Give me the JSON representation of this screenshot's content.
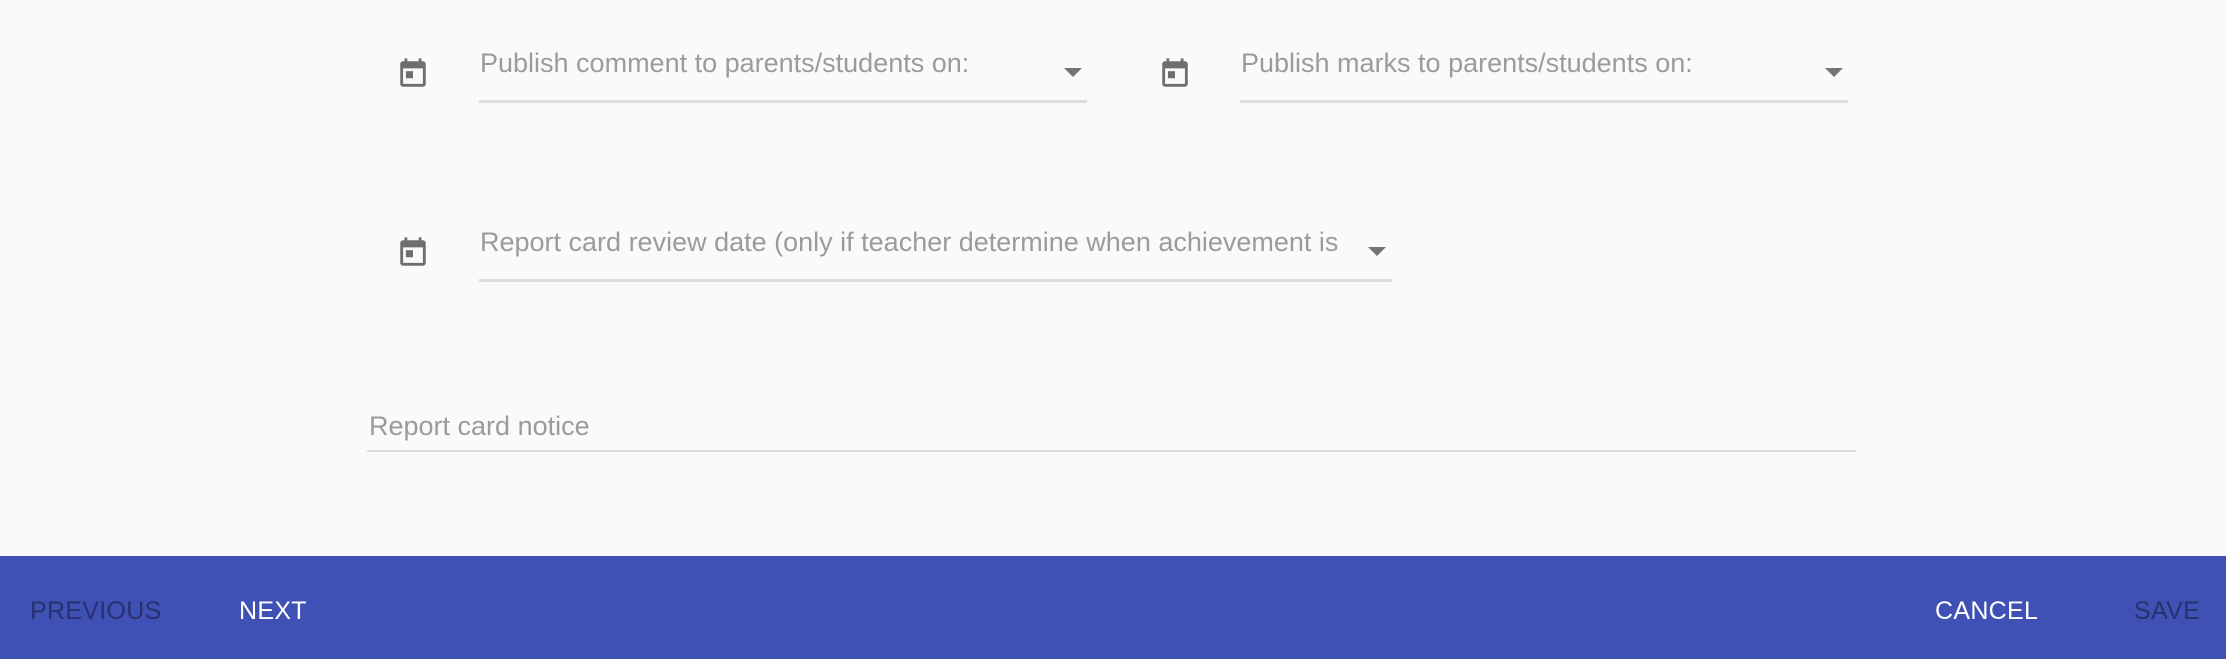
{
  "form": {
    "publish_comment": {
      "label": "Publish comment to parents/students on:",
      "icon": "calendar-icon"
    },
    "publish_marks": {
      "label": "Publish marks to parents/students on:",
      "icon": "calendar-icon"
    },
    "review_date": {
      "label": "Report card review date (only if teacher determine when achievement is",
      "icon": "calendar-icon"
    },
    "notice": {
      "label": "Report card notice"
    }
  },
  "footer": {
    "previous_label": "PREVIOUS",
    "next_label": "NEXT",
    "cancel_label": "CANCEL",
    "save_label": "SAVE",
    "background": "#3f51b5"
  }
}
